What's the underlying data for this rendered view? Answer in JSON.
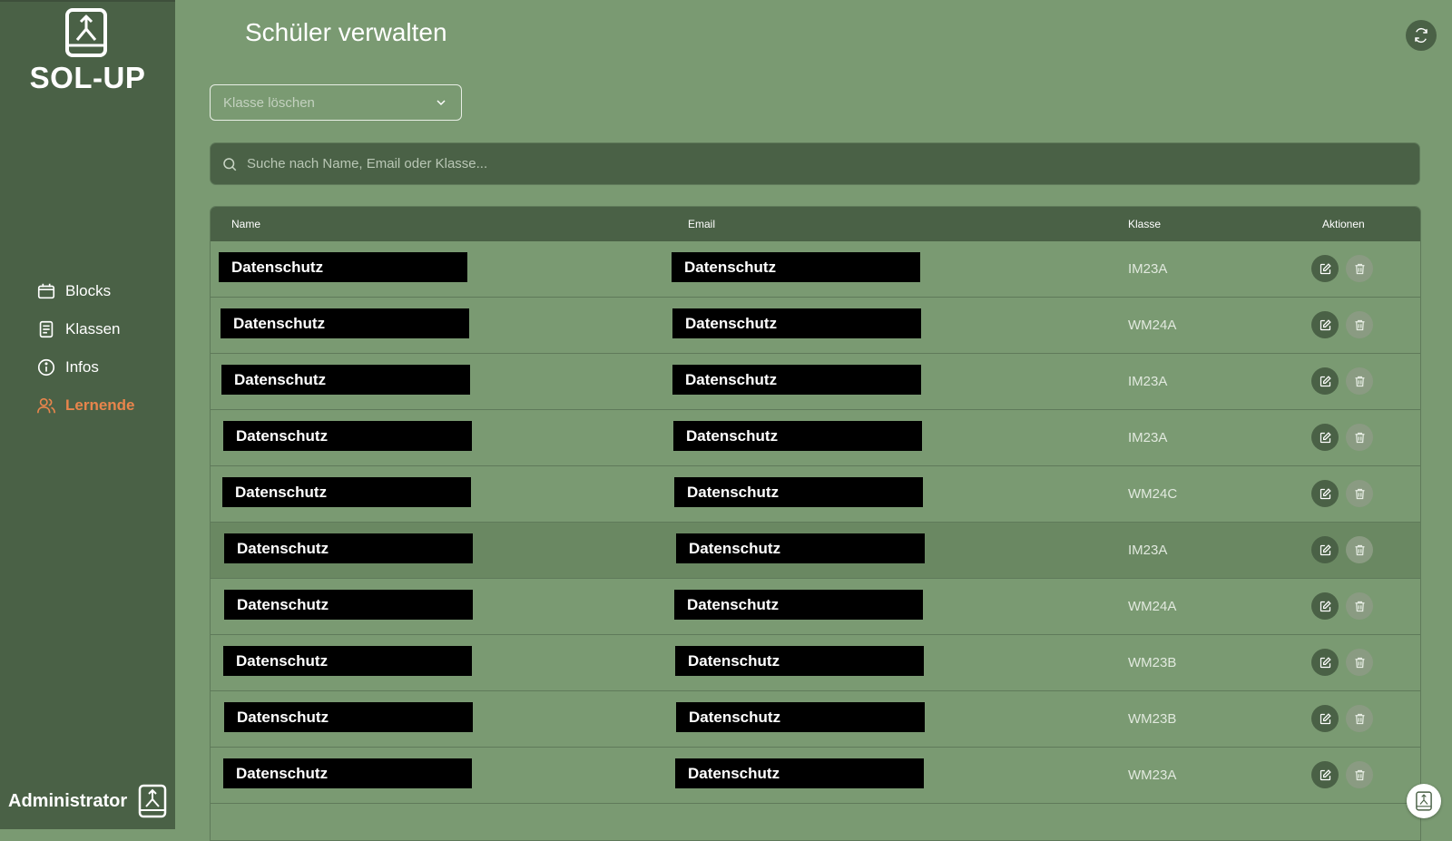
{
  "app": {
    "name": "SOL-UP",
    "user_role": "Administrator"
  },
  "sidebar": {
    "items": [
      {
        "label": "Blocks",
        "icon": "calendar-icon"
      },
      {
        "label": "Klassen",
        "icon": "document-icon"
      },
      {
        "label": "Infos",
        "icon": "info-icon"
      },
      {
        "label": "Lernende",
        "icon": "users-icon",
        "active": true
      }
    ]
  },
  "page": {
    "title": "Schüler verwalten"
  },
  "filter": {
    "placeholder": "Klasse löschen"
  },
  "search": {
    "placeholder": "Suche nach Name, Email oder Klasse..."
  },
  "table": {
    "headers": {
      "name": "Name",
      "email": "Email",
      "klasse": "Klasse",
      "aktionen": "Aktionen"
    },
    "rows": [
      {
        "name": "Datenschutz",
        "email": "Datenschutz",
        "klasse": "IM23A"
      },
      {
        "name": "Datenschutz",
        "email": "Datenschutz",
        "klasse": "WM24A"
      },
      {
        "name": "Datenschutz",
        "email": "Datenschutz",
        "klasse": "IM23A"
      },
      {
        "name": "Datenschutz",
        "email": "Datenschutz",
        "klasse": "IM23A"
      },
      {
        "name": "Datenschutz",
        "email": "Datenschutz",
        "klasse": "WM24C"
      },
      {
        "name": "Datenschutz",
        "email": "Datenschutz",
        "klasse": "IM23A"
      },
      {
        "name": "Datenschutz",
        "email": "Datenschutz",
        "klasse": "WM24A"
      },
      {
        "name": "Datenschutz",
        "email": "Datenschutz",
        "klasse": "WM23B"
      },
      {
        "name": "Datenschutz",
        "email": "Datenschutz",
        "klasse": "WM23B"
      },
      {
        "name": "Datenschutz",
        "email": "Datenschutz",
        "klasse": "WM23A"
      }
    ]
  },
  "colors": {
    "accent": "#e8854c",
    "sidebar": "#4a6146",
    "background": "#7a9a72"
  }
}
